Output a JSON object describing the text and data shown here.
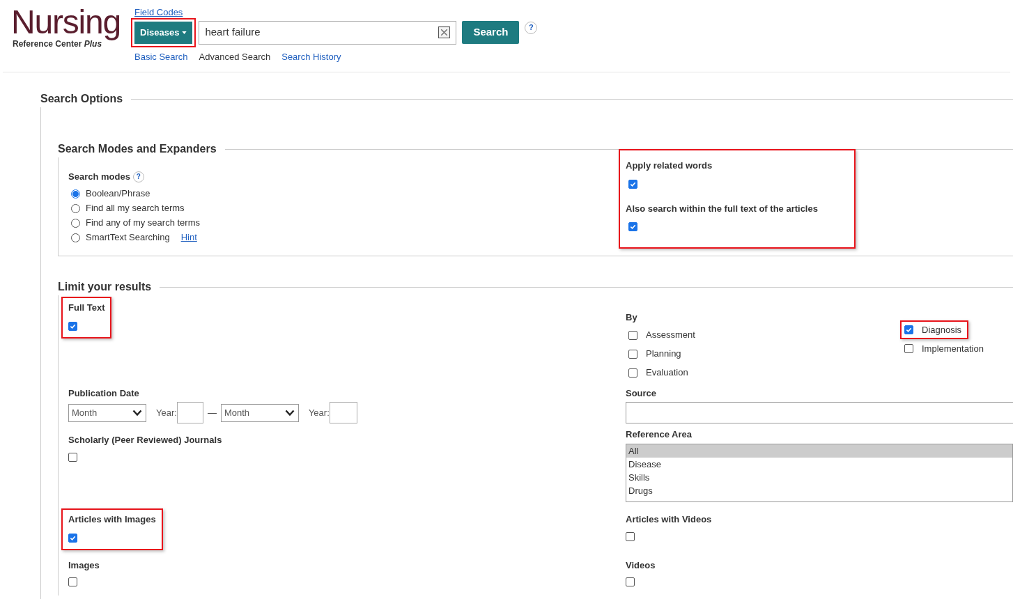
{
  "header": {
    "logo": {
      "title": "Nursing",
      "subtitle": "Reference Center *Plus*"
    },
    "field_codes_link": "Field Codes",
    "field_selector": {
      "label": "Diseases",
      "highlighted": true
    },
    "search_field": {
      "value": "heart failure"
    },
    "search_button": "Search",
    "help": "?",
    "nav_links": [
      {
        "label": "Basic Search",
        "selected": false
      },
      {
        "label": "Advanced Search",
        "selected": true
      },
      {
        "label": "Search History",
        "selected": false
      }
    ]
  },
  "search_options": {
    "title": "Search Options",
    "modes_and_expanders": {
      "title": "Search Modes and Expanders",
      "search_modes": {
        "label": "Search modes",
        "help": "?",
        "options": [
          {
            "label": "Boolean/Phrase",
            "selected": true
          },
          {
            "label": "Find all my search terms",
            "selected": false
          },
          {
            "label": "Find any of my search terms",
            "selected": false
          },
          {
            "label": "SmartText Searching",
            "selected": false,
            "link": "Hint"
          }
        ]
      },
      "expanders": {
        "highlighted": true,
        "items": [
          {
            "label": "Apply related words",
            "checked": true
          },
          {
            "label": "Also search within the full text of the articles",
            "checked": true
          }
        ]
      }
    },
    "limits": {
      "title": "Limit your results",
      "full_text": {
        "label": "Full Text",
        "checked": true,
        "highlighted": true
      },
      "by": {
        "label": "By",
        "columns": [
          [
            {
              "label": "Assessment",
              "checked": false
            },
            {
              "label": "Planning",
              "checked": false
            },
            {
              "label": "Evaluation",
              "checked": false
            }
          ],
          [
            {
              "label": "Diagnosis",
              "checked": true,
              "highlighted": true
            },
            {
              "label": "Implementation",
              "checked": false,
              "highlighted": false
            }
          ]
        ]
      },
      "publication_date": {
        "label": "Publication Date",
        "from_month": "Month",
        "from_year_label": "Year:",
        "separator": "—",
        "to_month": "Month",
        "to_year_label": "Year:"
      },
      "source": {
        "label": "Source"
      },
      "scholarly": {
        "label": "Scholarly (Peer Reviewed) Journals",
        "checked": false,
        "highlighted": false
      },
      "reference_area": {
        "label": "Reference Area",
        "options": [
          {
            "label": "All",
            "selected": true
          },
          {
            "label": "Disease",
            "selected": false
          },
          {
            "label": "Skills",
            "selected": false
          },
          {
            "label": "Drugs",
            "selected": false
          }
        ]
      },
      "articles_with_images": {
        "label": "Articles with Images",
        "checked": true,
        "highlighted": true
      },
      "articles_with_videos": {
        "label": "Articles with Videos",
        "checked": false,
        "highlighted": false
      },
      "images": {
        "label": "Images",
        "checked": false,
        "highlighted": false
      },
      "videos": {
        "label": "Videos",
        "checked": false,
        "highlighted": false
      }
    }
  }
}
